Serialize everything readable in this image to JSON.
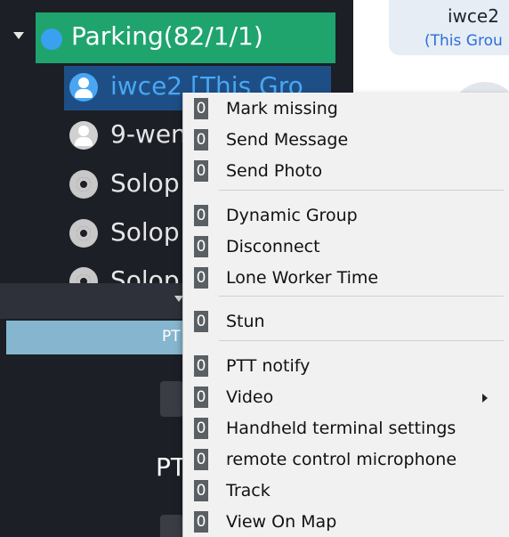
{
  "tree": {
    "group": {
      "name": "Parking(82/1/1)"
    },
    "members": [
      {
        "name": "iwce2 [This Gro",
        "avatar": "person-icon",
        "selected": true
      },
      {
        "name": "9-wen",
        "avatar": "person-icon",
        "selected": false
      },
      {
        "name": "Solop",
        "avatar": "radio-icon",
        "selected": false
      },
      {
        "name": "Solop",
        "avatar": "radio-icon",
        "selected": false
      },
      {
        "name": "Solop",
        "avatar": "radio-icon",
        "selected": false
      }
    ]
  },
  "ptt": {
    "tab_label": "PT",
    "label": "PT"
  },
  "header": {
    "title": "iwce2",
    "subtitle": "(This Grou"
  },
  "context_menu": {
    "items": [
      {
        "badge": "0",
        "label": "Mark missing"
      },
      {
        "badge": "0",
        "label": "Send Message"
      },
      {
        "badge": "0",
        "label": "Send Photo"
      },
      {
        "badge": "0",
        "label": "Dynamic Group"
      },
      {
        "badge": "0",
        "label": "Disconnect"
      },
      {
        "badge": "0",
        "label": "Lone Worker Time"
      },
      {
        "badge": "0",
        "label": "Stun"
      },
      {
        "badge": "0",
        "label": "PTT notify"
      },
      {
        "badge": "0",
        "label": "Video",
        "has_submenu": true
      },
      {
        "badge": "0",
        "label": "Handheld terminal settings"
      },
      {
        "badge": "0",
        "label": "remote control microphone"
      },
      {
        "badge": "0",
        "label": "Track"
      },
      {
        "badge": "0",
        "label": "View On Map"
      }
    ]
  },
  "colors": {
    "group_bar": "#1fa46e",
    "selected_row": "#1d4f86",
    "accent_blue": "#4aa6f2",
    "panel_bg": "#1c1f26",
    "menu_bg": "#f1f1f1"
  }
}
